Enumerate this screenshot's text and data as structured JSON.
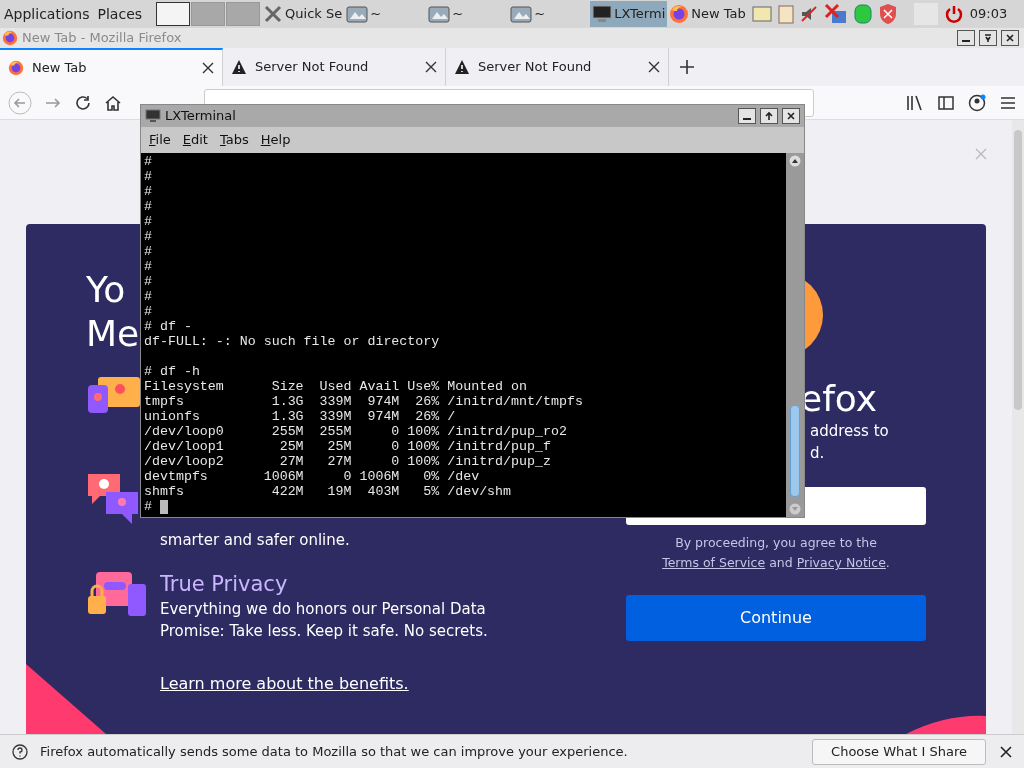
{
  "taskbar": {
    "menus": [
      "Applications",
      "Places"
    ],
    "workspaces": [
      {
        "selected": true
      },
      {
        "selected": false
      },
      {
        "selected": false
      }
    ],
    "tasks": [
      {
        "label": "Quick Se",
        "kind": "tools",
        "selected": false
      },
      {
        "label": "~",
        "kind": "folder",
        "selected": false
      },
      {
        "label": "~",
        "kind": "folder",
        "selected": false
      },
      {
        "label": "~",
        "kind": "folder",
        "selected": false
      },
      {
        "label": "LXTermi",
        "kind": "terminal",
        "selected": true
      },
      {
        "label": "New Tab",
        "kind": "browser",
        "selected": false
      }
    ],
    "clock": "09:03"
  },
  "browser": {
    "title": "New Tab - Mozilla Firefox",
    "tabs": [
      {
        "label": "New Tab",
        "kind": "firefox",
        "selected": true
      },
      {
        "label": "Server Not Found",
        "kind": "warning",
        "selected": false
      },
      {
        "label": "Server Not Found",
        "kind": "warning",
        "selected": false
      }
    ],
    "page": {
      "heading_lines": [
        "Yo",
        "Me"
      ],
      "features": [
        {
          "kind": "cards"
        },
        {
          "kind": "chat",
          "text": "smarter and safer online."
        },
        {
          "kind": "privacy",
          "title": "True Privacy",
          "text": "Everything we do honors our Personal Data Promise: Take less. Keep it safe. No secrets."
        }
      ],
      "link": "Learn more about the benefits.",
      "title_tail": "efox",
      "subtitle_lines": [
        "address to",
        "d."
      ],
      "legal": {
        "before": "By proceeding, you agree to the",
        "terms": "Terms of Service",
        "middle": "and",
        "privacy": "Privacy Notice",
        "after": "."
      },
      "button": "Continue"
    },
    "notification": {
      "text": "Firefox automatically sends some data to Mozilla so that we can improve your experience.",
      "button": "Choose What I Share"
    }
  },
  "terminal": {
    "title": "LXTerminal",
    "menu": [
      "File",
      "Edit",
      "Tabs",
      "Help"
    ],
    "lines": [
      {
        "kind": "text",
        "text": "#"
      },
      {
        "kind": "text",
        "text": "#"
      },
      {
        "kind": "text",
        "text": "#"
      },
      {
        "kind": "text",
        "text": "#"
      },
      {
        "kind": "text",
        "text": "#"
      },
      {
        "kind": "text",
        "text": "#"
      },
      {
        "kind": "text",
        "text": "#"
      },
      {
        "kind": "text",
        "text": "#"
      },
      {
        "kind": "text",
        "text": "#"
      },
      {
        "kind": "text",
        "text": "#"
      },
      {
        "kind": "text",
        "text": "#"
      },
      {
        "kind": "text",
        "text": "# df -"
      },
      {
        "kind": "text",
        "text": "df-FULL: -: No such file or directory"
      },
      {
        "kind": "blank"
      },
      {
        "kind": "text",
        "text": "# df -h"
      },
      {
        "kind": "text",
        "text": "Filesystem      Size  Used Avail Use% Mounted on"
      },
      {
        "kind": "text",
        "text": "tmpfs           1.3G  339M  974M  26% /initrd/mnt/tmpfs"
      },
      {
        "kind": "text",
        "text": "unionfs         1.3G  339M  974M  26% /"
      },
      {
        "kind": "text",
        "text": "/dev/loop0      255M  255M     0 100% /initrd/pup_ro2"
      },
      {
        "kind": "text",
        "text": "/dev/loop1       25M   25M     0 100% /initrd/pup_f"
      },
      {
        "kind": "text",
        "text": "/dev/loop2       27M   27M     0 100% /initrd/pup_z"
      },
      {
        "kind": "text",
        "text": "devtmpfs       1006M     0 1006M   0% /dev"
      },
      {
        "kind": "text",
        "text": "shmfs           422M   19M  403M   5% /dev/shm"
      },
      {
        "kind": "text",
        "text": "#"
      }
    ],
    "cursor": true
  }
}
